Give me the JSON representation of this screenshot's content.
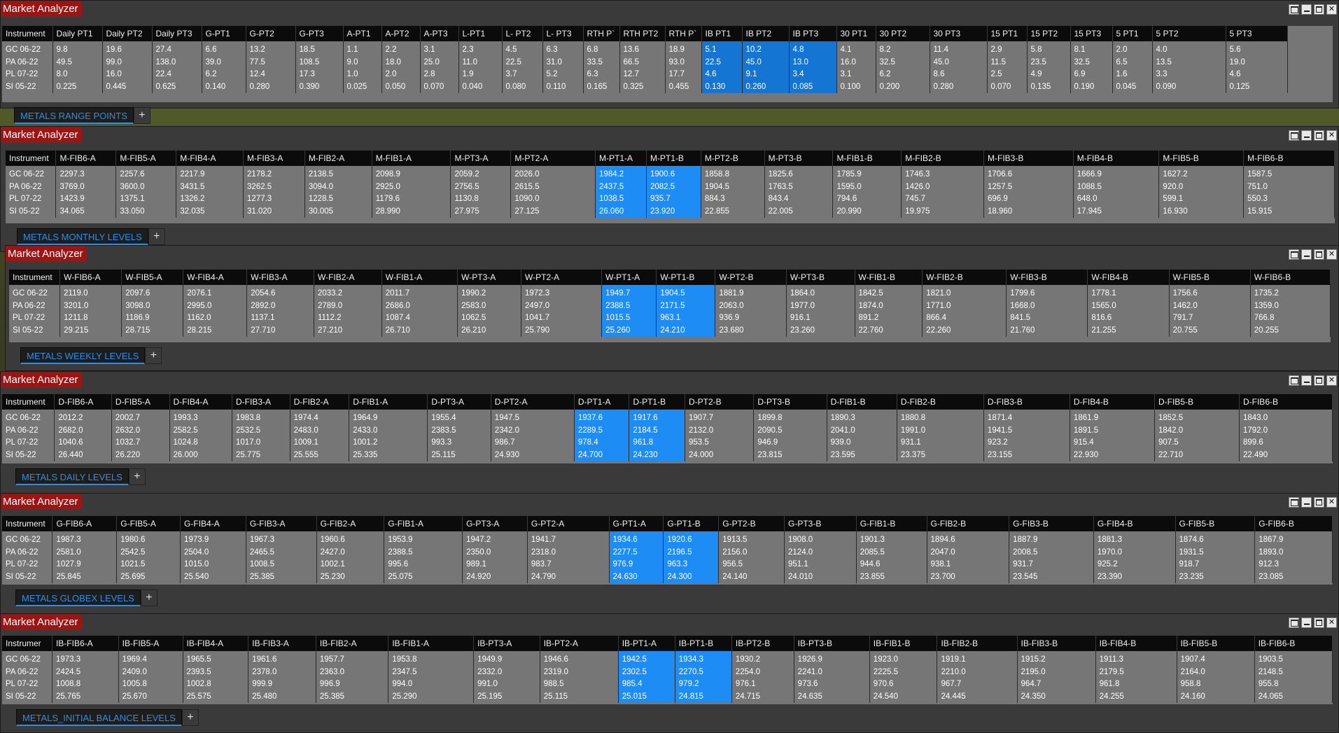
{
  "windows": [
    {
      "title": "Market Analyzer",
      "tab": "METALS RANGE POINTS",
      "columns": [
        "Instrument",
        "Daily PT1",
        "Daily PT2",
        "Daily PT3",
        "G-PT1",
        "G-PT2",
        "G-PT3",
        "A-PT1",
        "A-PT2",
        "A-PT3",
        "L-PT1",
        "L- PT2",
        "L- PT3",
        "RTH P`",
        "RTH PT2",
        "RTH P`",
        "IB PT1",
        "IB PT2",
        "IB PT3",
        "30 PT1",
        "30 PT2",
        "30 PT3",
        "15 PT1",
        "15 PT2",
        "15 PT3",
        "5 PT1",
        "5 PT2",
        "5 PT3"
      ],
      "rows": [
        [
          "GC 06-22",
          "9.8",
          "19.6",
          "27.4",
          "6.6",
          "13.2",
          "18.5",
          "1.1",
          "2.2",
          "3.1",
          "2.3",
          "4.5",
          "6.3",
          "6.8",
          "13.6",
          "18.9",
          "5.1",
          "10.2",
          "4.8",
          "4.1",
          "8.2",
          "11.4",
          "2.9",
          "5.8",
          "8.1",
          "2.0",
          "4.0",
          "5.6"
        ],
        [
          "PA 06-22",
          "49.5",
          "99.0",
          "138.0",
          "39.0",
          "77.5",
          "108.5",
          "9.0",
          "18.0",
          "25.0",
          "11.0",
          "22.5",
          "31.0",
          "33.5",
          "66.5",
          "93.0",
          "22.5",
          "45.0",
          "13.0",
          "16.0",
          "32.5",
          "45.0",
          "11.5",
          "23.5",
          "32.5",
          "6.5",
          "13.5",
          "19.0"
        ],
        [
          "PL 07-22",
          "8.0",
          "16.0",
          "22.4",
          "6.2",
          "12.4",
          "17.3",
          "1.0",
          "2.0",
          "2.8",
          "1.9",
          "3.7",
          "5.2",
          "6.3",
          "12.7",
          "17.7",
          "4.6",
          "9.1",
          "3.4",
          "3.1",
          "6.2",
          "8.6",
          "2.5",
          "4.9",
          "6.9",
          "1.6",
          "3.3",
          "4.6"
        ],
        [
          "SI 05-22",
          "0.225",
          "0.445",
          "0.625",
          "0.140",
          "0.280",
          "0.390",
          "0.025",
          "0.050",
          "0.070",
          "0.040",
          "0.080",
          "0.110",
          "0.165",
          "0.325",
          "0.455",
          "0.130",
          "0.260",
          "0.085",
          "0.100",
          "0.200",
          "0.280",
          "0.070",
          "0.135",
          "0.190",
          "0.045",
          "0.090",
          "0.125"
        ]
      ]
    },
    {
      "title": "Market Analyzer",
      "tab": "METALS MONTHLY LEVELS",
      "columns": [
        "Instrument",
        "M-FIB6-A",
        "M-FIB5-A",
        "M-FIB4-A",
        "M-FIB3-A",
        "M-FIB2-A",
        "M-FIB1-A",
        "M-PT3-A",
        "M-PT2-A",
        "M-PT1-A",
        "M-PT1-B",
        "M-PT2-B",
        "M-PT3-B",
        "M-FIB1-B",
        "M-FIB2-B",
        "M-FIB3-B",
        "M-FIB4-B",
        "M-FIB5-B",
        "M-FIB6-B"
      ],
      "rows": [
        [
          "GC 06-22",
          "2297.3",
          "2257.6",
          "2217.9",
          "2178.2",
          "2138.5",
          "2098.9",
          "2059.2",
          "2026.0",
          "1984.2",
          "1900.6",
          "1858.8",
          "1825.6",
          "1785.9",
          "1746.3",
          "1706.6",
          "1666.9",
          "1627.2",
          "1587.5"
        ],
        [
          "PA 06-22",
          "3769.0",
          "3600.0",
          "3431.5",
          "3262.5",
          "3094.0",
          "2925.0",
          "2756.5",
          "2615.5",
          "2437.5",
          "2082.5",
          "1904.5",
          "1763.5",
          "1595.0",
          "1426.0",
          "1257.5",
          "1088.5",
          "920.0",
          "751.0"
        ],
        [
          "PL 07-22",
          "1423.9",
          "1375.1",
          "1326.2",
          "1277.3",
          "1228.5",
          "1179.6",
          "1130.8",
          "1090.0",
          "1038.5",
          "935.7",
          "884.3",
          "843.4",
          "794.6",
          "745.7",
          "696.9",
          "648.0",
          "599.1",
          "550.3"
        ],
        [
          "SI 05-22",
          "34.065",
          "33.050",
          "32.035",
          "31.020",
          "30.005",
          "28.990",
          "27.975",
          "27.125",
          "26.060",
          "23.920",
          "22.855",
          "22.005",
          "20.990",
          "19.975",
          "18.960",
          "17.945",
          "16.930",
          "15.915"
        ]
      ]
    },
    {
      "title": "Market Analyzer",
      "tab": "METALS WEEKLY LEVELS",
      "columns": [
        "Instrument",
        "W-FIB6-A",
        "W-FIB5-A",
        "W-FIB4-A",
        "W-FIB3-A",
        "W-FIB2-A",
        "W-FIB1-A",
        "W-PT3-A",
        "W-PT2-A",
        "W-PT1-A",
        "W-PT1-B",
        "W-PT2-B",
        "W-PT3-B",
        "W-FIB1-B",
        "W-FIB2-B",
        "W-FIB3-B",
        "W-FIB4-B",
        "W-FIB5-B",
        "W-FIB6-B"
      ],
      "rows": [
        [
          "GC 06-22",
          "2119.0",
          "2097.6",
          "2076.1",
          "2054.6",
          "2033.2",
          "2011.7",
          "1990.2",
          "1972.3",
          "1949.7",
          "1904.5",
          "1881.9",
          "1864.0",
          "1842.5",
          "1821.0",
          "1799.6",
          "1778.1",
          "1756.6",
          "1735.2"
        ],
        [
          "PA 06-22",
          "3201.0",
          "3098.0",
          "2995.0",
          "2892.0",
          "2789.0",
          "2686.0",
          "2583.0",
          "2497.0",
          "2388.5",
          "2171.5",
          "2063.0",
          "1977.0",
          "1874.0",
          "1771.0",
          "1668.0",
          "1565.0",
          "1462.0",
          "1359.0"
        ],
        [
          "PL 07-22",
          "1211.8",
          "1186.9",
          "1162.0",
          "1137.1",
          "1112.2",
          "1087.4",
          "1062.5",
          "1041.7",
          "1015.5",
          "963.1",
          "936.9",
          "916.1",
          "891.2",
          "866.4",
          "841.5",
          "816.6",
          "791.7",
          "766.8"
        ],
        [
          "SI 05-22",
          "29.215",
          "28.715",
          "28.215",
          "27.710",
          "27.210",
          "26.710",
          "26.210",
          "25.790",
          "25.260",
          "24.210",
          "23.680",
          "23.260",
          "22.760",
          "22.260",
          "21.760",
          "21.255",
          "20.755",
          "20.255"
        ]
      ]
    },
    {
      "title": "Market Analyzer",
      "tab": "METALS DAILY LEVELS",
      "columns": [
        "Instrument",
        "D-FIB6-A",
        "D-FIB5-A",
        "D-FIB4-A",
        "D-FIB3-A",
        "D-FIB2-A",
        "D-FIB1-A",
        "D-PT3-A",
        "D-PT2-A",
        "D-PT1-A",
        "D-PT1-B",
        "D-PT2-B",
        "D-PT3-B",
        "D-FIB1-B",
        "D-FIB2-B",
        "D-FIB3-B",
        "D-FIB4-B",
        "D-FIB5-B",
        "D-FIB6-B"
      ],
      "rows": [
        [
          "GC 06-22",
          "2012.2",
          "2002.7",
          "1993.3",
          "1983.8",
          "1974.4",
          "1964.9",
          "1955.4",
          "1947.5",
          "1937.6",
          "1917.6",
          "1907.7",
          "1899.8",
          "1890.3",
          "1880.8",
          "1871.4",
          "1861.9",
          "1852.5",
          "1843.0"
        ],
        [
          "PA 06-22",
          "2682.0",
          "2632.0",
          "2582.5",
          "2532.5",
          "2483.0",
          "2433.0",
          "2383.5",
          "2342.0",
          "2289.5",
          "2184.5",
          "2132.0",
          "2090.5",
          "2041.0",
          "1991.0",
          "1941.5",
          "1891.5",
          "1842.0",
          "1792.0"
        ],
        [
          "PL 07-22",
          "1040.6",
          "1032.7",
          "1024.8",
          "1017.0",
          "1009.1",
          "1001.2",
          "993.3",
          "986.7",
          "978.4",
          "961.8",
          "953.5",
          "946.9",
          "939.0",
          "931.1",
          "923.2",
          "915.4",
          "907.5",
          "899.6"
        ],
        [
          "SI 05-22",
          "26.440",
          "26.220",
          "26.000",
          "25.775",
          "25.555",
          "25.335",
          "25.115",
          "24.930",
          "24.700",
          "24.230",
          "24.000",
          "23.815",
          "23.595",
          "23.375",
          "23.155",
          "22.930",
          "22.710",
          "22.490"
        ]
      ]
    },
    {
      "title": "Market Analyzer",
      "tab": "METALS GLOBEX LEVELS",
      "columns": [
        "Instrument",
        "G-FIB6-A",
        "G-FIB5-A",
        "G-FIB4-A",
        "G-FIB3-A",
        "G-FIB2-A",
        "G-FIB1-A",
        "G-PT3-A",
        "G-PT2-A",
        "G-PT1-A",
        "G-PT1-B",
        "G-PT2-B",
        "G-PT3-B",
        "G-FIB1-B",
        "G-FIB2-B",
        "G-FIB3-B",
        "G-FIB4-B",
        "G-FIB5-B",
        "G-FIB6-B"
      ],
      "rows": [
        [
          "GC 06-22",
          "1987.3",
          "1980.6",
          "1973.9",
          "1967.3",
          "1960.6",
          "1953.9",
          "1947.2",
          "1941.7",
          "1934.6",
          "1920.6",
          "1913.5",
          "1908.0",
          "1901.3",
          "1894.6",
          "1887.9",
          "1881.3",
          "1874.6",
          "1867.9"
        ],
        [
          "PA 06-22",
          "2581.0",
          "2542.5",
          "2504.0",
          "2465.5",
          "2427.0",
          "2388.5",
          "2350.0",
          "2318.0",
          "2277.5",
          "2196.5",
          "2156.0",
          "2124.0",
          "2085.5",
          "2047.0",
          "2008.5",
          "1970.0",
          "1931.5",
          "1893.0"
        ],
        [
          "PL 07-22",
          "1027.9",
          "1021.5",
          "1015.0",
          "1008.5",
          "1002.1",
          "995.6",
          "989.1",
          "983.7",
          "976.9",
          "963.3",
          "956.5",
          "951.1",
          "944.6",
          "938.1",
          "931.7",
          "925.2",
          "918.7",
          "912.3"
        ],
        [
          "SI 05-22",
          "25.845",
          "25.695",
          "25.540",
          "25.385",
          "25.230",
          "25.075",
          "24.920",
          "24.790",
          "24.630",
          "24.300",
          "24.140",
          "24.010",
          "23.855",
          "23.700",
          "23.545",
          "23.390",
          "23.235",
          "23.085"
        ]
      ]
    },
    {
      "title": "Market Analyzer",
      "tab": "METALS_INITIAL BALANCE LEVELS",
      "columns": [
        "Instrumer",
        "IB-FIB6-A",
        "IB-FIB5-A",
        "IB-FIB4-A",
        "IB-FIB3-A",
        "IB-FIB2-A",
        "IB-FIB1-A",
        "IB-PT3-A",
        "IB-PT2-A",
        "IB-PT1-A",
        "IB-PT1-B",
        "IB-PT2-B",
        "IB-PT3-B",
        "IB-FIB1-B",
        "IB-FIB2-B",
        "IB-FIB3-B",
        "IB-FIB4-B",
        "IB-FIB5-B",
        "IB-FIB6-B"
      ],
      "rows": [
        [
          "GC 06-22",
          "1973.3",
          "1969.4",
          "1965.5",
          "1961.6",
          "1957.7",
          "1953.8",
          "1949.9",
          "1946.6",
          "1942.5",
          "1934.3",
          "1930.2",
          "1926.9",
          "1923.0",
          "1919.1",
          "1915.2",
          "1911.3",
          "1907.4",
          "1903.5"
        ],
        [
          "PA 06-22",
          "2424.5",
          "2409.0",
          "2393.5",
          "2378.0",
          "2363.0",
          "2347.5",
          "2332.0",
          "2319.0",
          "2302.5",
          "2270.5",
          "2254.0",
          "2241.0",
          "2225.5",
          "2210.0",
          "2195.0",
          "2179.5",
          "2164.0",
          "2148.5"
        ],
        [
          "PL 07-22",
          "1008.8",
          "1005.8",
          "1002.8",
          "999.9",
          "996.9",
          "994.0",
          "991.0",
          "988.5",
          "985.4",
          "979.2",
          "976.1",
          "973.6",
          "970.6",
          "967.7",
          "964.7",
          "961.8",
          "958.8",
          "955.8"
        ],
        [
          "SI 05-22",
          "25.765",
          "25.670",
          "25.575",
          "25.480",
          "25.385",
          "25.290",
          "25.195",
          "25.115",
          "25.015",
          "24.815",
          "24.715",
          "24.635",
          "24.540",
          "24.445",
          "24.350",
          "24.255",
          "24.160",
          "24.065"
        ]
      ]
    }
  ]
}
